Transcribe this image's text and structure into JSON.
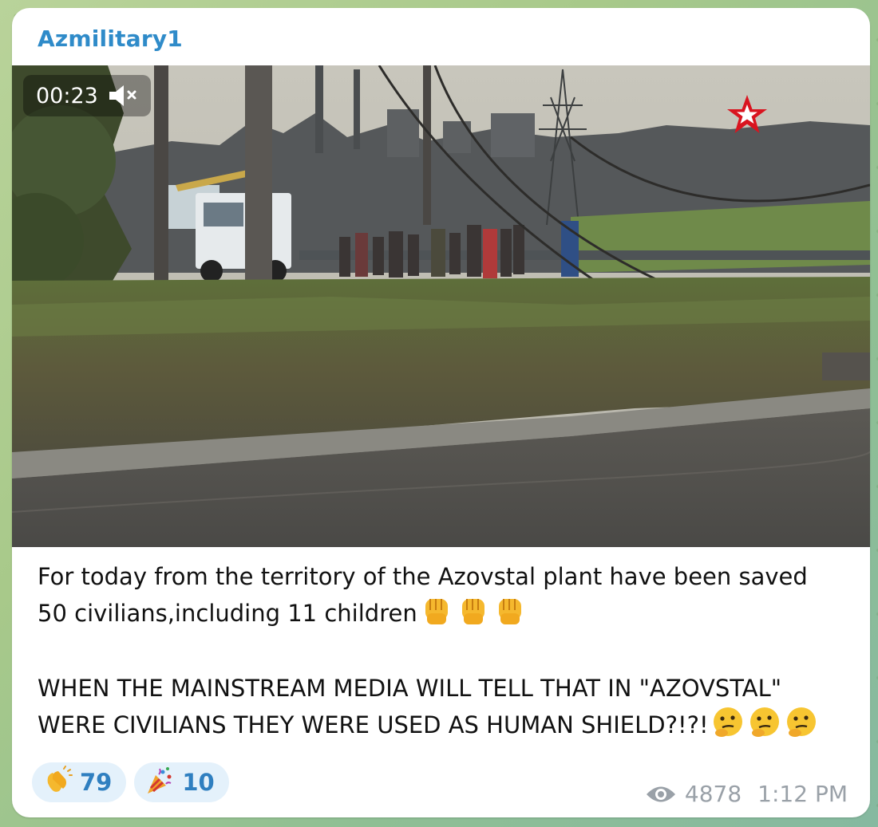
{
  "message": {
    "author": "Azmilitary1",
    "video": {
      "duration": "00:23",
      "muted_icon": "speaker-muted-icon",
      "channel_logo": "red-star-logo"
    },
    "caption": {
      "line1": "For today from the territory of the Azovstal plant have been saved 50 civilians,including 11 children",
      "line1_emoji": [
        "raised-fist",
        "raised-fist",
        "raised-fist"
      ],
      "line2": "WHEN THE MAINSTREAM MEDIA WILL TELL THAT IN \"AZOVSTAL\" WERE CIVILIANS THEY WERE USED AS HUMAN SHIELD?!?!",
      "line2_emoji": [
        "thinking-face",
        "thinking-face",
        "thinking-face"
      ]
    },
    "reactions": [
      {
        "emoji": "clapping-hands",
        "count": "79"
      },
      {
        "emoji": "party-popper",
        "count": "10"
      }
    ],
    "views": "4878",
    "time": "1:12 PM"
  },
  "colors": {
    "author": "#2f8bc9",
    "reaction_bg": "#e4f1fb",
    "reaction_count": "#2f7fc0",
    "meta_text": "#9aa1a8"
  }
}
